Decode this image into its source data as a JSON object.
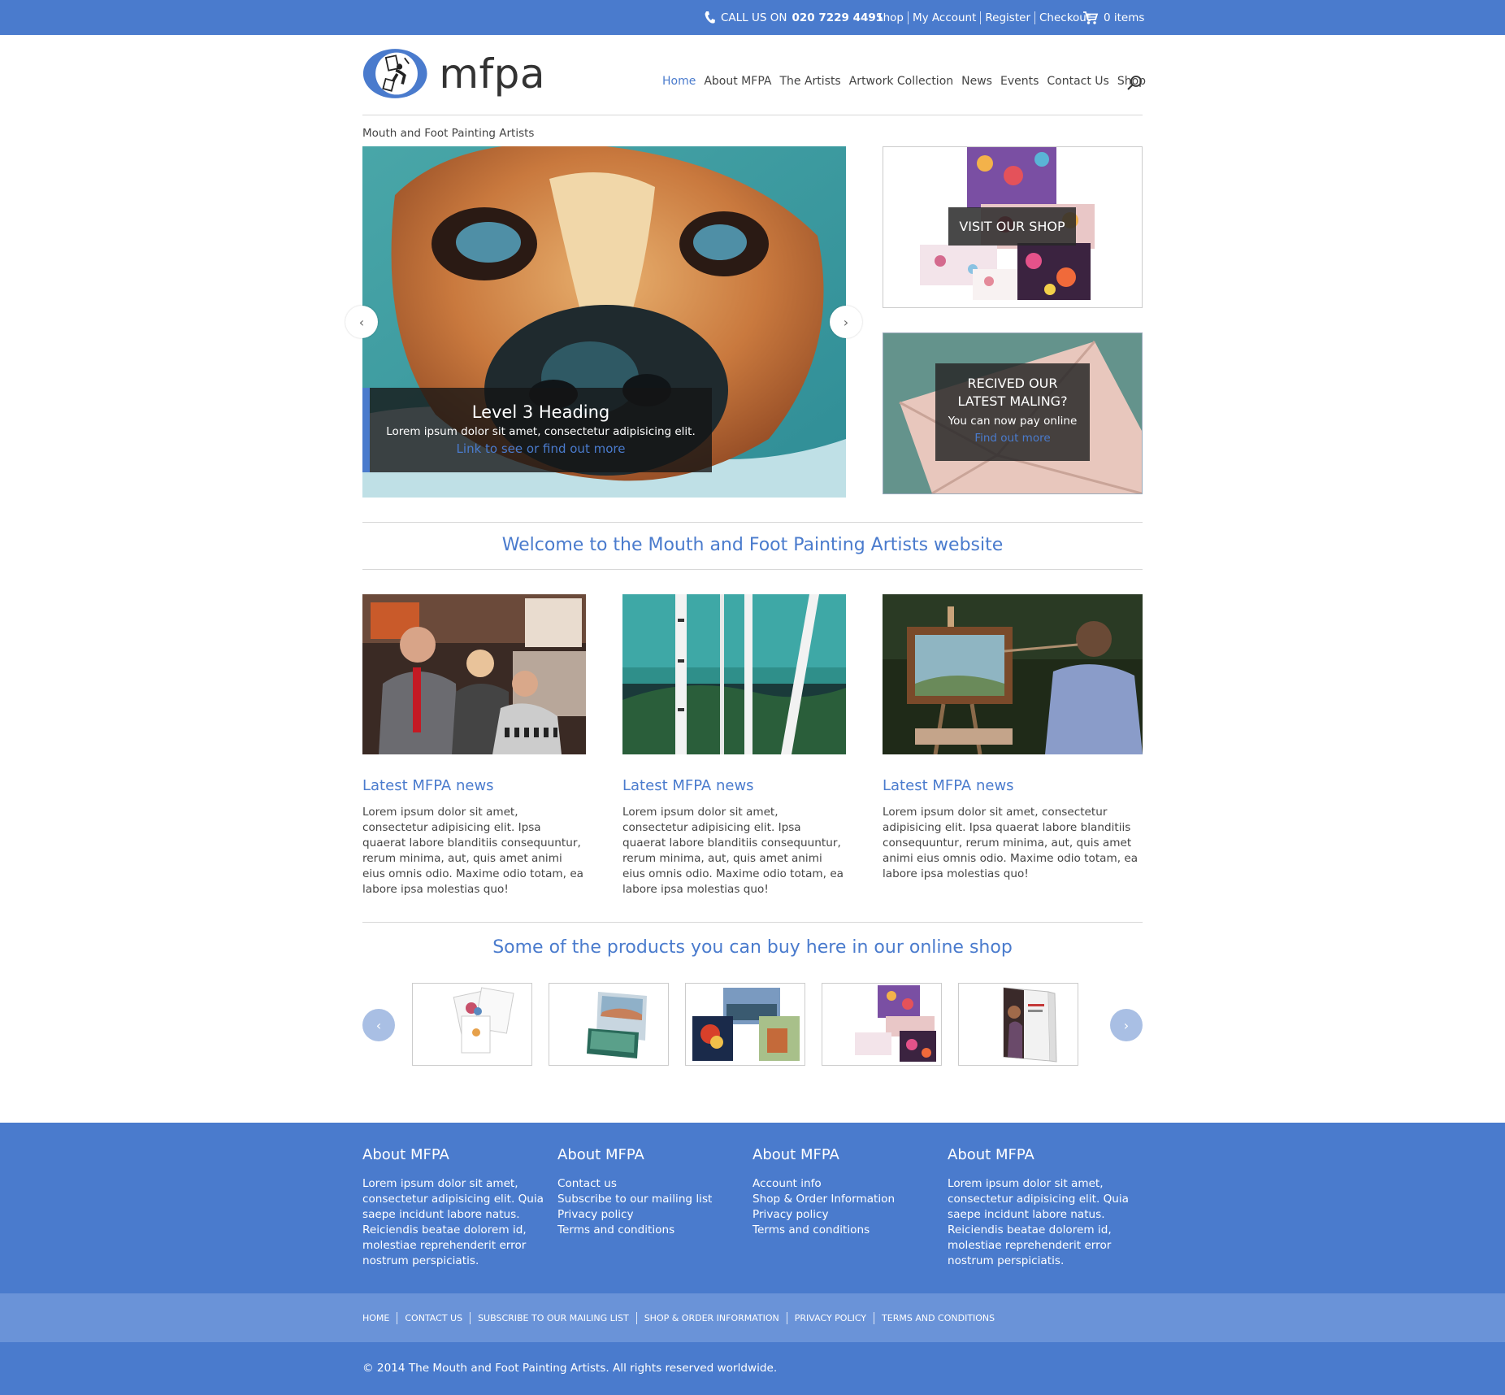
{
  "colors": {
    "accent": "#4a7bcd",
    "topbar": "#4a7bcd",
    "footer_sub": "#6a93d8"
  },
  "topbar": {
    "call_prefix": "CALL US ON",
    "phone": "020 7229 4491",
    "links": [
      "Shop",
      "My Account",
      "Register",
      "Checkout"
    ],
    "cart_label": "0 items"
  },
  "header": {
    "logo_text": "mfpa",
    "nav": [
      "Home",
      "About MFPA",
      "The Artists",
      "Artwork Collection",
      "News",
      "Events",
      "Contact Us",
      "Shop"
    ]
  },
  "tagline": "Mouth and Foot Painting Artists",
  "slider": {
    "heading": "Level 3 Heading",
    "text": "Lorem ipsum dolor sit amet, consectetur adipisicing elit.",
    "link": "Link to see or find out more",
    "prev": "‹",
    "next": "›"
  },
  "promo": {
    "shop_button": "VISIT OUR SHOP",
    "mail_line1": "RECIVED OUR",
    "mail_line2": "LATEST MALING?",
    "mail_text": "You can now pay online",
    "mail_link": "Find out more"
  },
  "welcome": "Welcome to the Mouth and Foot Painting Artists website",
  "news": [
    {
      "title": "Latest MFPA news",
      "text": "Lorem ipsum dolor sit amet, consectetur adipisicing elit. Ipsa quaerat labore blanditiis consequuntur, rerum minima, aut, quis amet animi eius omnis odio. Maxime odio totam, ea labore ipsa molestias quo!"
    },
    {
      "title": "Latest MFPA news",
      "text": "Lorem ipsum dolor sit amet, consectetur adipisicing elit. Ipsa quaerat labore blanditiis consequuntur, rerum minima, aut, quis amet animi eius omnis odio. Maxime odio totam, ea labore ipsa molestias quo!"
    },
    {
      "title": "Latest MFPA news",
      "text": "Lorem ipsum dolor sit amet, consectetur adipisicing elit. Ipsa quaerat labore blanditiis consequuntur, rerum minima, aut, quis amet animi eius omnis odio. Maxime odio totam, ea labore ipsa molestias quo!"
    }
  ],
  "products_heading": "Some of the products you can buy here in our online shop",
  "products_nav": {
    "prev": "‹",
    "next": "›"
  },
  "footer": {
    "col1": {
      "title": "About MFPA",
      "text": "Lorem ipsum dolor sit amet, consectetur adipisicing elit. Quia saepe incidunt labore natus. Reiciendis beatae dolorem id, molestiae reprehenderit error nostrum perspiciatis."
    },
    "col2": {
      "title": "About MFPA",
      "links": [
        "Contact us",
        "Subscribe to our mailing list",
        "Privacy policy",
        "Terms and conditions"
      ]
    },
    "col3": {
      "title": "About MFPA",
      "links": [
        "Account info",
        "Shop & Order Information",
        "Privacy policy",
        "Terms and conditions"
      ]
    },
    "col4": {
      "title": "About MFPA",
      "text": "Lorem ipsum dolor sit amet, consectetur adipisicing elit. Quia saepe incidunt labore natus. Reiciendis beatae dolorem id, molestiae reprehenderit error nostrum perspiciatis."
    },
    "bottom_links": [
      "HOME",
      "CONTACT US",
      "SUBSCRIBE TO OUR MAILING LIST",
      "SHOP & ORDER INFORMATION",
      "PRIVACY POLICY",
      "TERMS AND CONDITIONS"
    ],
    "copyright": "© 2014 The Mouth and Foot Painting Artists. All rights reserved worldwide."
  }
}
